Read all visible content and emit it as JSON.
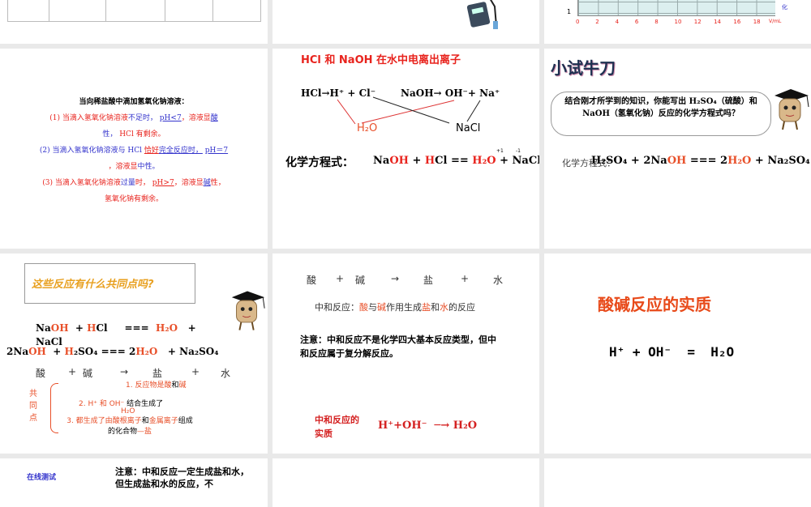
{
  "colors": {
    "red": "#e8231d",
    "orange": "#e8502a",
    "blue": "#3333cc",
    "background": "#e9e9e9"
  },
  "slides": [
    {
      "id": "table-slide",
      "partial": true
    },
    {
      "id": "ph-meter-slide",
      "partial": true,
      "image": "ph-meter-icon"
    },
    {
      "id": "ph-curve-slide",
      "partial": true,
      "chart_data": {
        "type": "line",
        "x_ticks": [
          "0",
          "2",
          "4",
          "6",
          "8",
          "10",
          "12",
          "14",
          "16",
          "18"
        ],
        "xlabel": "V/mL",
        "y_tick_visible": "1",
        "side_label": "化"
      }
    },
    {
      "id": "ph-explanation-slide",
      "title": "当向稀盐酸中滴加氢氧化钠溶液：",
      "p1": {
        "a": "(1) 当滴入氢氧化钠溶液",
        "b": "不足时，",
        "c": "pH<7",
        "d": "，溶液显",
        "e": "酸",
        "f": "性，",
        "g": "HCl 有剩余。"
      },
      "p2": {
        "a": "(2) 当滴入氢氧化钠溶液与 HCl ",
        "b": "恰好",
        "c": "完全反应时，",
        "d": "pH＝7",
        "e": "，溶液显",
        "f": "中性。"
      },
      "p3": {
        "a": "(3) 当滴入氢氧化钠溶液",
        "b": "过量",
        "c": "时，",
        "d": "pH>7",
        "e": "，溶液显",
        "f": "碱",
        "g": "性，",
        "h": "氢氧化钠有剩余。"
      }
    },
    {
      "id": "ionization-slide",
      "title": "HCl 和 NaOH 在水中电离出离子",
      "eq1": "HCl→H⁺ + Cl⁻",
      "eq2": "NaOH→  OH⁻+ Na⁺",
      "water": "H₂O",
      "salt": "NaCl",
      "label": "化学方程式：",
      "eq": {
        "a": "Na",
        "b": "OH",
        "c": " + ",
        "d": "H",
        "e": "Cl == ",
        "f": "H₂O",
        "g": " + NaCl",
        "ox1": "+1",
        "ox2": "-1"
      }
    },
    {
      "id": "practice-slide",
      "title": "小试牛刀",
      "bubble": "结合刚才所学到的知识，你能写出 H₂SO₄（硫酸）和 NaOH（氢氧化钠）反应的化学方程式吗？",
      "label": "化学方程式：",
      "eq": {
        "a": "H₂SO₄ + 2Na",
        "b": "OH",
        "c": " === 2",
        "d": "H₂O",
        "e": " + Na₂SO₄"
      }
    },
    {
      "id": "common-points-slide",
      "bubble": "这些反应有什么共同点吗?",
      "eq1": {
        "a": "Na",
        "b": "OH",
        "c": "  + ",
        "d": "H",
        "e": "Cl     ===  ",
        "f": "H₂O",
        "g": "   +",
        "h": "NaCl"
      },
      "eq2": {
        "a": "2Na",
        "b": "OH",
        "c": "  + ",
        "d": "H",
        "e": "₂SO₄ === 2",
        "f": "H₂O",
        "g": "   + Na₂SO₄"
      },
      "word_eq": [
        "酸",
        "+",
        "碱",
        "→",
        "盐",
        "+",
        "水"
      ],
      "side_label": "共同点",
      "points": {
        "p1a": "1. 反应物是",
        "p1b": "酸",
        "p1c": "和",
        "p1d": "碱",
        "p2a": "2. H⁺ 和 OH⁻ ",
        "p2b": "结合生成了",
        "p2c": "H₂O",
        "p3a": "3. 都生成了由",
        "p3b": "酸根离子",
        "p3c": "和",
        "p3d": "金属",
        "p3e": "离子",
        "p3f": "组成的化合物",
        "p3g": "—盐"
      }
    },
    {
      "id": "neutralization-slide",
      "word_eq": [
        "酸",
        "+",
        "碱",
        "→",
        "盐",
        "+",
        "水"
      ],
      "def": {
        "a": "中和反应：",
        "b": "酸",
        "c": "与",
        "d": "碱",
        "e": "作用生成",
        "f": "盐",
        "g": "和",
        "h": "水",
        "i": "的反应"
      },
      "note": "注意：中和反应不是化学四大基本反应类型，但中和反应属于复分解反应。",
      "essence_label": "中和反应的实质",
      "essence_eq": "H⁺+OH⁻  ─→ H₂O"
    },
    {
      "id": "essence-slide",
      "title": "酸碱反应的实质",
      "eq": "H⁺ + OH⁻  =  H₂O"
    },
    {
      "id": "online-test-slide",
      "partial": true,
      "link": "在线测试",
      "note": "注意：中和反应一定生成盐和水，但生成盐和水的反应，不"
    },
    {
      "id": "blank-slide-11",
      "partial": true
    },
    {
      "id": "blank-slide-12",
      "partial": true
    }
  ]
}
